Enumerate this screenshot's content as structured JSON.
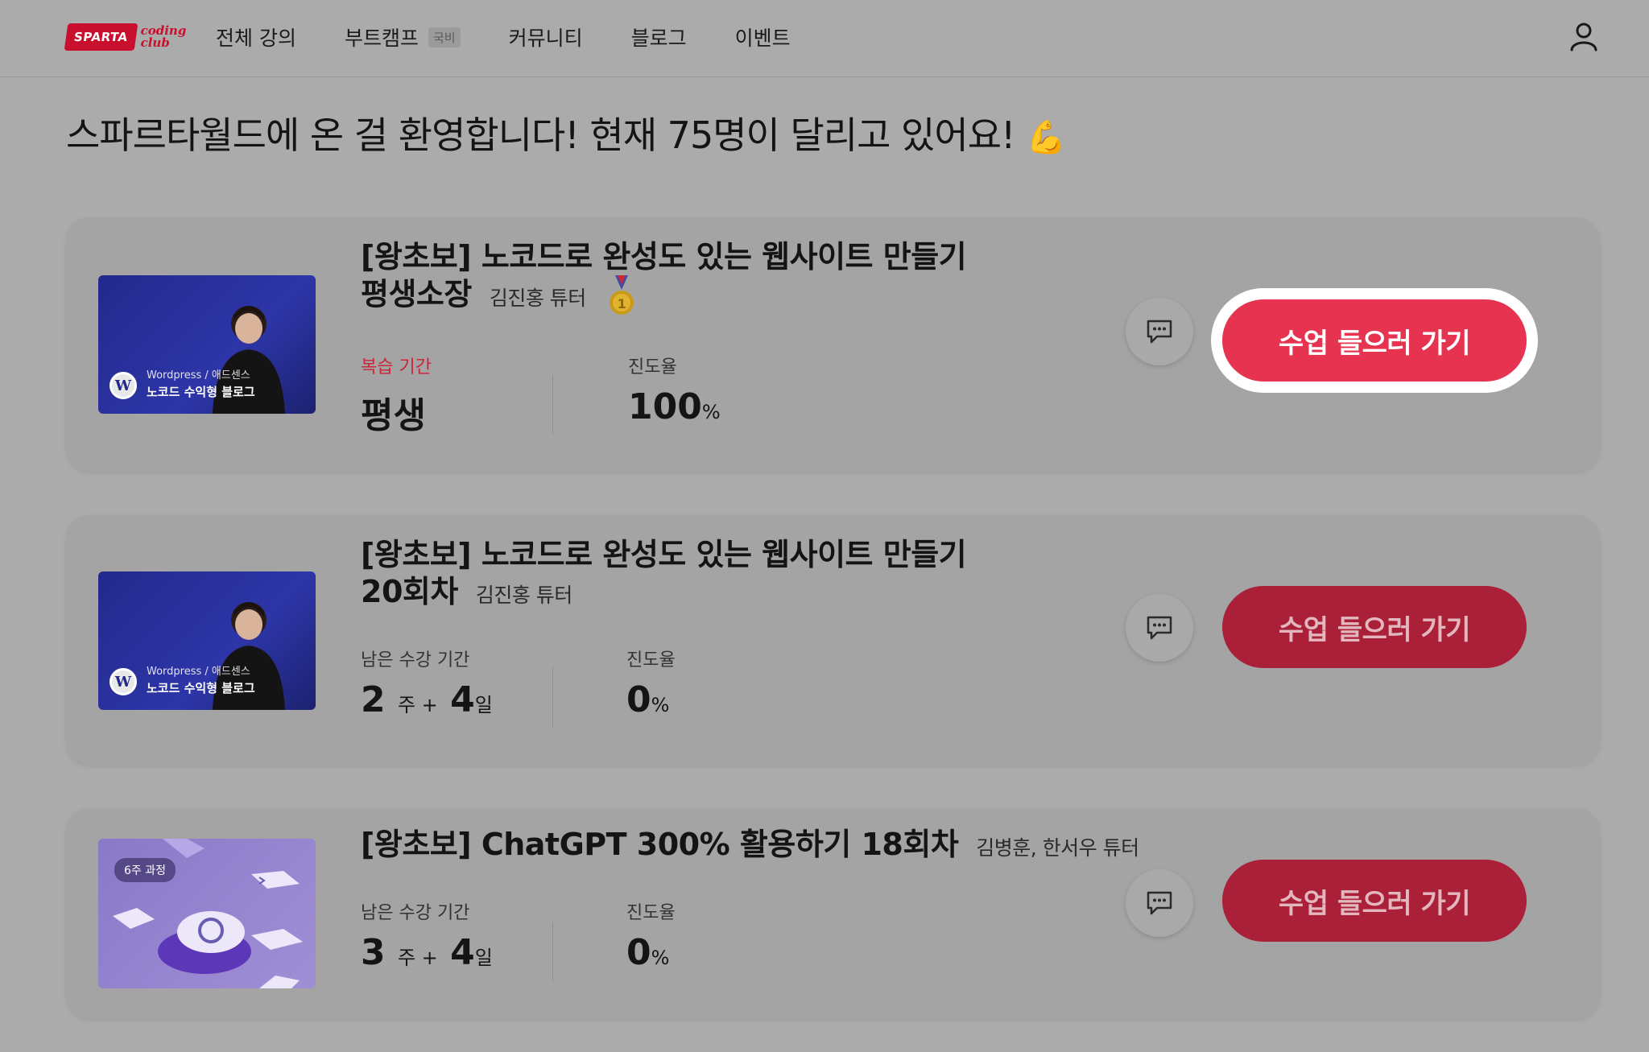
{
  "header": {
    "logo_main": "SPARTA",
    "logo_side_1": "coding",
    "logo_side_2": "club",
    "nav": [
      {
        "label": "전체 강의"
      },
      {
        "label": "부트캠프",
        "tag": "국비"
      },
      {
        "label": "커뮤니티"
      },
      {
        "label": "블로그"
      },
      {
        "label": "이벤트"
      }
    ],
    "user_icon": "user-icon"
  },
  "welcome": {
    "text": "스파르타월드에 온 걸 환영합니다! 현재 75명이 달리고 있어요!",
    "emoji": "💪"
  },
  "courses": [
    {
      "title_line1": "[왕초보] 노코드로 완성도 있는 웹사이트 만들기",
      "title_line2": "평생소장",
      "tutor": "김진홍 튜터",
      "medal": "1",
      "thumb_small": "Wordpress / 애드센스",
      "thumb_bold": "노코드 수익형 블로그",
      "period_label": "복습 기간",
      "period_value": "평생",
      "progress_label": "진도율",
      "progress_value": "100",
      "progress_unit": "%",
      "cta": "수업 들으러 가기"
    },
    {
      "title_line1": "[왕초보] 노코드로 완성도 있는 웹사이트 만들기",
      "title_line2": "20회차",
      "tutor": "김진홍 튜터",
      "thumb_small": "Wordpress / 애드센스",
      "thumb_bold": "노코드 수익형 블로그",
      "period_label": "남은 수강 기간",
      "weeks": "2",
      "week_unit": "주 +",
      "days": "4",
      "day_unit": "일",
      "progress_label": "진도율",
      "progress_value": "0",
      "progress_unit": "%",
      "cta": "수업 들으러 가기"
    },
    {
      "title_line1": "[왕초보] ChatGPT 300% 활용하기 18회차",
      "tutor": "김병훈, 한서우 튜터",
      "thumb_badge": "6주 과정",
      "period_label": "남은 수강 기간",
      "weeks": "3",
      "week_unit": "주 +",
      "days": "4",
      "day_unit": "일",
      "progress_label": "진도율",
      "progress_value": "0",
      "progress_unit": "%",
      "cta": "수업 들으러 가기"
    }
  ],
  "colors": {
    "brand_red": "#e63450",
    "background_dimmed": "#ababab"
  }
}
